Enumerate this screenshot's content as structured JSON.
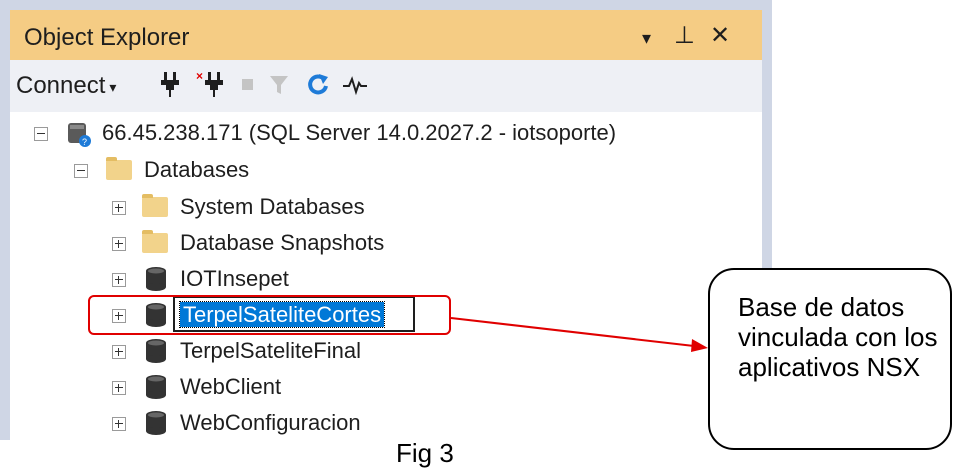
{
  "window": {
    "title": "Object Explorer",
    "controls": {
      "dropdown": "▾",
      "pin": "⊥",
      "close": "✕"
    }
  },
  "toolbar": {
    "connect_label": "Connect",
    "connect_caret": "▾"
  },
  "tree": {
    "server": "66.45.238.171 (SQL Server 14.0.2027.2 - iotsoporte)",
    "databases_label": "Databases",
    "items": [
      {
        "label": "System Databases",
        "icon": "folder-icon"
      },
      {
        "label": "Database Snapshots",
        "icon": "folder-icon"
      },
      {
        "label": "IOTInsepet",
        "icon": "database-icon"
      },
      {
        "label": "TerpelSateliteCortes",
        "icon": "database-icon",
        "selected": true
      },
      {
        "label": "TerpelSateliteFinal",
        "icon": "database-icon"
      },
      {
        "label": "WebClient",
        "icon": "database-icon"
      },
      {
        "label": "WebConfiguracion",
        "icon": "database-icon"
      }
    ]
  },
  "callout": {
    "text": "Base de datos vinculada con los aplicativos NSX"
  },
  "caption": "Fig 3",
  "colors": {
    "title_bar": "#f5cc84",
    "selection": "#0078d7",
    "highlight": "#e00000",
    "refresh_icon": "#1e7bd8"
  }
}
